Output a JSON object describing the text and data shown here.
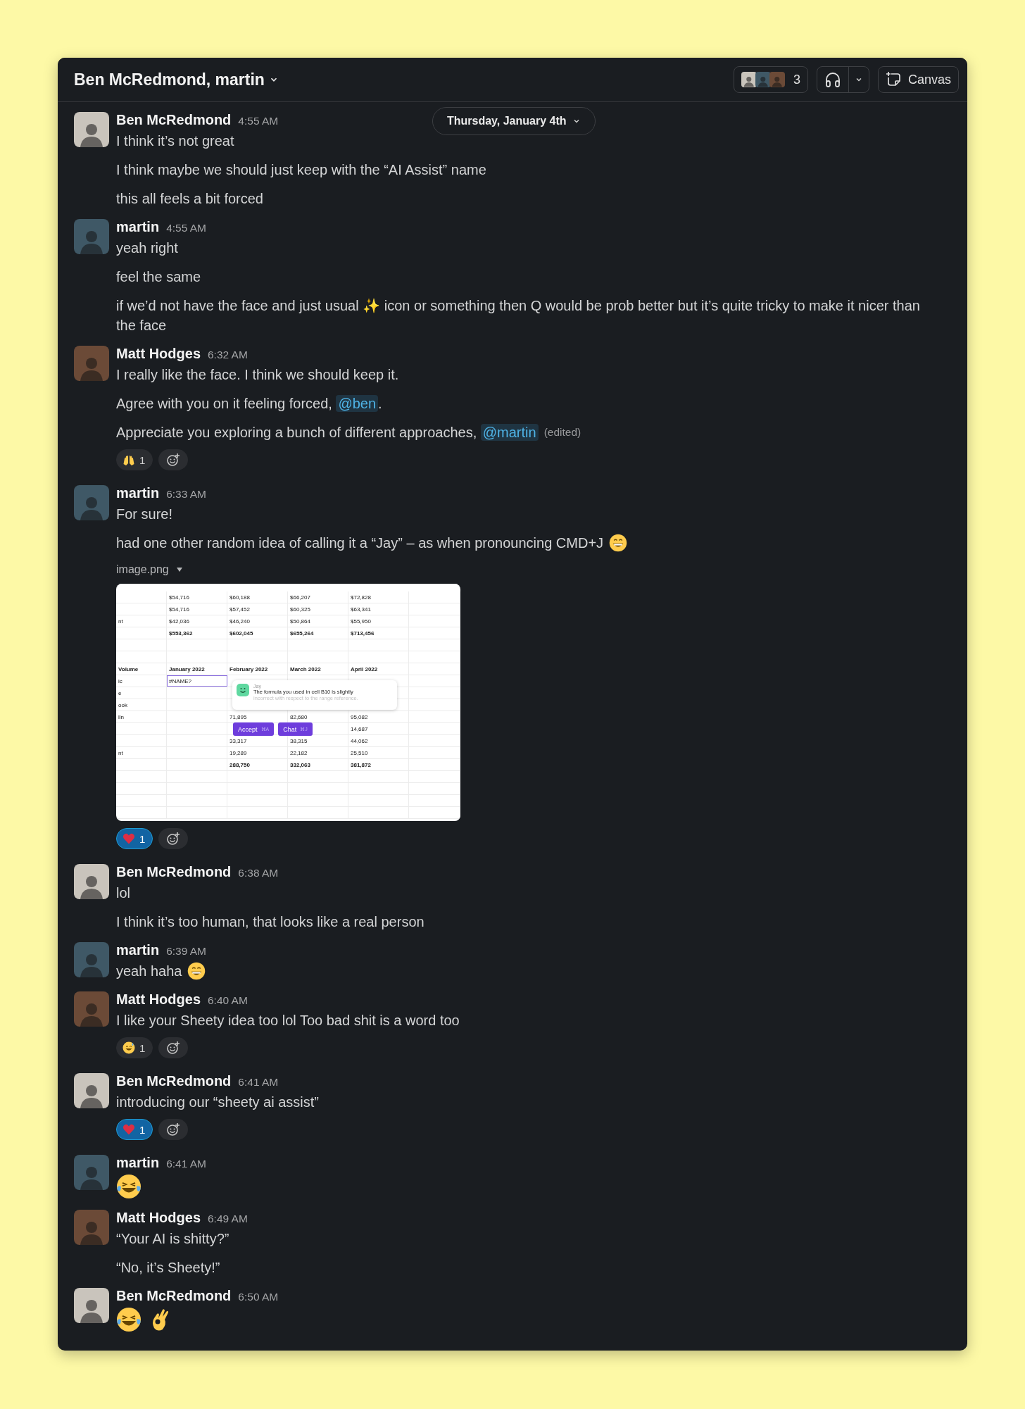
{
  "header": {
    "title": "Ben McRedmond, martin",
    "member_count": "3",
    "canvas_label": "Canvas"
  },
  "date_divider": "Thursday, January 4th",
  "messages": [
    {
      "author": "Ben McRedmond",
      "time": "4:55 AM",
      "lines": [
        {
          "kind": "text",
          "parts": [
            {
              "text": "I think it’s not great"
            }
          ]
        },
        {
          "kind": "text",
          "parts": [
            {
              "text": "I think maybe we should just keep with the “AI Assist” name"
            }
          ]
        },
        {
          "kind": "text",
          "parts": [
            {
              "text": "this all feels a bit forced"
            }
          ]
        }
      ]
    },
    {
      "author": "martin",
      "time": "4:55 AM",
      "lines": [
        {
          "kind": "text",
          "parts": [
            {
              "text": "yeah right"
            }
          ]
        },
        {
          "kind": "text",
          "parts": [
            {
              "text": "feel the same"
            }
          ]
        },
        {
          "kind": "text",
          "parts": [
            {
              "text": "if we’d not have the face and just usual ✨ icon or something then Q would be prob better but it’s quite tricky to make it nicer than the face"
            }
          ]
        }
      ]
    },
    {
      "author": "Matt Hodges",
      "time": "6:32 AM",
      "lines": [
        {
          "kind": "text",
          "parts": [
            {
              "text": "I really like the face. I think we should keep it."
            }
          ]
        },
        {
          "kind": "text",
          "parts": [
            {
              "text": "Agree with you on it feeling forced, "
            },
            {
              "mention": "@ben"
            },
            {
              "text": "."
            }
          ]
        },
        {
          "kind": "text",
          "parts": [
            {
              "text": "Appreciate you exploring a bunch of different approaches, "
            },
            {
              "mention": "@martin"
            }
          ],
          "edited_label": "(edited)"
        }
      ],
      "reactions": [
        {
          "kind": "raised-hands",
          "count": "1",
          "selected": false
        }
      ]
    },
    {
      "author": "martin",
      "time": "6:33 AM",
      "lines": [
        {
          "kind": "text",
          "parts": [
            {
              "text": "For sure!"
            }
          ]
        },
        {
          "kind": "text",
          "parts": [
            {
              "text": "had one other random idea of calling it a “Jay” – as when pronouncing CMD+J "
            }
          ],
          "trailing": {
            "kind": "grin"
          }
        }
      ],
      "attachment": {
        "file_name": "image.png",
        "sheet": {
          "rows": [
            {
              "cells": [
                null,
                "$54,716",
                "$60,188",
                "$66,207",
                "$72,828"
              ]
            },
            {
              "cells": [
                null,
                "$54,716",
                "$57,452",
                "$60,325",
                "$63,341"
              ]
            },
            {
              "cells": [
                "nt",
                "$42,036",
                "$46,240",
                "$50,864",
                "$55,950"
              ]
            },
            {
              "bold": true,
              "cells": [
                null,
                "$553,362",
                "$602,045",
                "$655,264",
                "$713,456"
              ]
            },
            {
              "cells": [
                null,
                null,
                null,
                null,
                null
              ]
            },
            {
              "cells": [
                null,
                null,
                null,
                null,
                null
              ]
            },
            {
              "bold": true,
              "cells": [
                "Volume",
                "January 2022",
                "February 2022",
                "March 2022",
                "April 2022"
              ]
            },
            {
              "cells": [
                "ic",
                {
                  "text": "#NAME?",
                  "selected": true
                },
                null,
                null,
                null
              ]
            },
            {
              "cells": [
                "e",
                null,
                null,
                null,
                null
              ]
            },
            {
              "cells": [
                "ook",
                null,
                null,
                null,
                null
              ]
            },
            {
              "cells": [
                "lln",
                null,
                "71,895",
                "82,680",
                "95,082"
              ]
            },
            {
              "cells": [
                null,
                null,
                null,
                null,
                "14,687"
              ]
            },
            {
              "cells": [
                null,
                null,
                "33,317",
                "38,315",
                "44,062"
              ]
            },
            {
              "cells": [
                "nt",
                null,
                "19,289",
                "22,182",
                "25,510"
              ]
            },
            {
              "bold": true,
              "cells": [
                null,
                null,
                "288,750",
                "332,063",
                "381,872"
              ]
            }
          ],
          "suggestion": {
            "author": "Jay",
            "text": "The formula you used in cell B10 is slightly",
            "faded_text": "incorrect with respect to the range reference.",
            "actions": [
              {
                "label": "Accept",
                "shortcut": "⌘A"
              },
              {
                "label": "Chat",
                "shortcut": "⌘J"
              }
            ]
          }
        }
      },
      "reactions": [
        {
          "kind": "heart",
          "count": "1",
          "selected": true
        }
      ]
    },
    {
      "author": "Ben McRedmond",
      "time": "6:38 AM",
      "lines": [
        {
          "kind": "text",
          "parts": [
            {
              "text": "lol"
            }
          ]
        },
        {
          "kind": "text",
          "parts": [
            {
              "text": "I think it’s too human, that looks like a real person"
            }
          ]
        }
      ]
    },
    {
      "author": "martin",
      "time": "6:39 AM",
      "lines": [
        {
          "kind": "text",
          "parts": [
            {
              "text": "yeah haha "
            }
          ],
          "trailing": {
            "kind": "grin"
          }
        }
      ]
    },
    {
      "author": "Matt Hodges",
      "time": "6:40 AM",
      "lines": [
        {
          "kind": "text",
          "parts": [
            {
              "text": "I like your Sheety idea too lol Too bad shit is a word too"
            }
          ]
        }
      ],
      "reactions": [
        {
          "kind": "sweat-smile",
          "count": "1",
          "selected": false
        }
      ]
    },
    {
      "author": "Ben McRedmond",
      "time": "6:41 AM",
      "lines": [
        {
          "kind": "text",
          "parts": [
            {
              "text": "introducing our “sheety ai assist”"
            }
          ]
        }
      ],
      "reactions": [
        {
          "kind": "heart",
          "count": "1",
          "selected": true
        }
      ]
    },
    {
      "author": "martin",
      "time": "6:41 AM",
      "lines": [
        {
          "kind": "emoji",
          "emojis": [
            {
              "kind": "joy"
            }
          ]
        }
      ]
    },
    {
      "author": "Matt Hodges",
      "time": "6:49 AM",
      "lines": [
        {
          "kind": "text",
          "parts": [
            {
              "text": "“Your AI is shitty?”"
            }
          ]
        },
        {
          "kind": "text",
          "parts": [
            {
              "text": "“No, it’s Sheety!”"
            }
          ]
        }
      ]
    },
    {
      "author": "Ben McRedmond",
      "time": "6:50 AM",
      "lines": [
        {
          "kind": "emoji",
          "emojis": [
            {
              "kind": "joy"
            },
            {
              "kind": "ok-hand"
            }
          ]
        }
      ]
    }
  ]
}
